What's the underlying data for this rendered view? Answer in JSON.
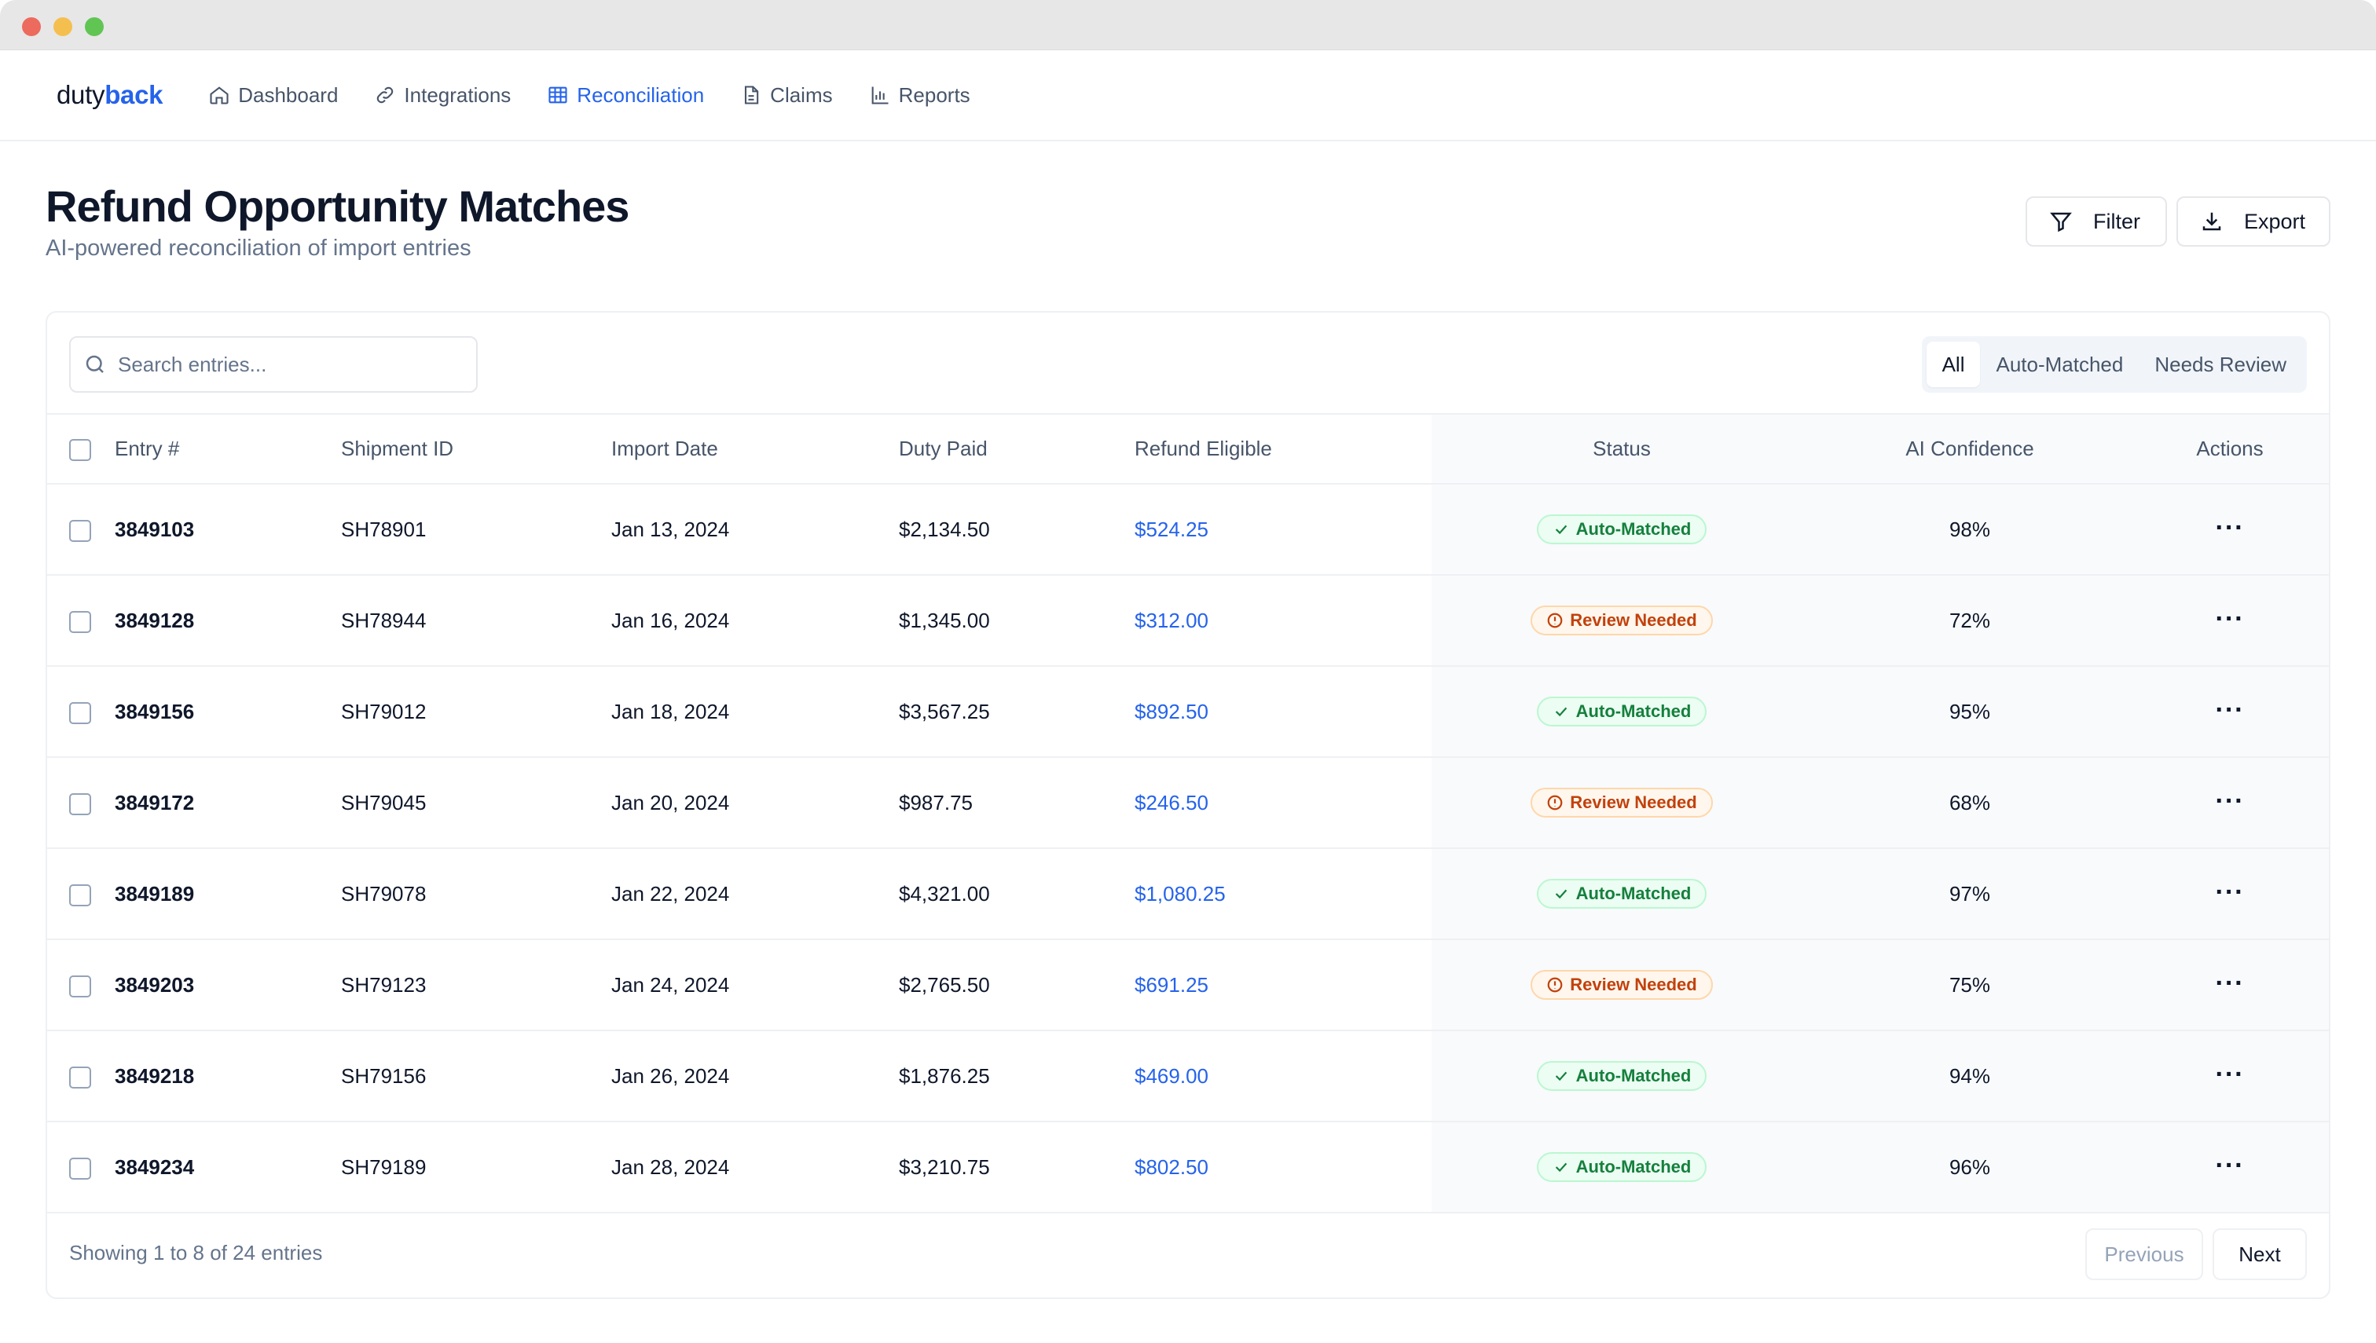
{
  "app": {
    "logo_light": "duty",
    "logo_bold": "back"
  },
  "nav": [
    {
      "label": "Dashboard",
      "icon": "home-icon",
      "active": false
    },
    {
      "label": "Integrations",
      "icon": "link-icon",
      "active": false
    },
    {
      "label": "Reconciliation",
      "icon": "table-icon",
      "active": true
    },
    {
      "label": "Claims",
      "icon": "document-icon",
      "active": false
    },
    {
      "label": "Reports",
      "icon": "bar-chart-icon",
      "active": false
    }
  ],
  "header": {
    "title": "Refund Opportunity Matches",
    "subtitle": "AI-powered reconciliation of import entries",
    "filter_label": "Filter",
    "export_label": "Export"
  },
  "search": {
    "placeholder": "Search entries...",
    "value": ""
  },
  "segments": [
    "All",
    "Auto-Matched",
    "Needs Review"
  ],
  "active_segment": "All",
  "table": {
    "columns": [
      "Entry #",
      "Shipment ID",
      "Import Date",
      "Duty Paid",
      "Refund Eligible",
      "Status",
      "AI Confidence",
      "Actions"
    ],
    "rows": [
      {
        "entry": "3849103",
        "shipment": "SH78901",
        "date": "Jan 13, 2024",
        "duty": "$2,134.50",
        "refund": "$524.25",
        "status": "Auto-Matched",
        "kind": "ok",
        "confidence": "98%"
      },
      {
        "entry": "3849128",
        "shipment": "SH78944",
        "date": "Jan 16, 2024",
        "duty": "$1,345.00",
        "refund": "$312.00",
        "status": "Review Needed",
        "kind": "warn",
        "confidence": "72%"
      },
      {
        "entry": "3849156",
        "shipment": "SH79012",
        "date": "Jan 18, 2024",
        "duty": "$3,567.25",
        "refund": "$892.50",
        "status": "Auto-Matched",
        "kind": "ok",
        "confidence": "95%"
      },
      {
        "entry": "3849172",
        "shipment": "SH79045",
        "date": "Jan 20, 2024",
        "duty": "$987.75",
        "refund": "$246.50",
        "status": "Review Needed",
        "kind": "warn",
        "confidence": "68%"
      },
      {
        "entry": "3849189",
        "shipment": "SH79078",
        "date": "Jan 22, 2024",
        "duty": "$4,321.00",
        "refund": "$1,080.25",
        "status": "Auto-Matched",
        "kind": "ok",
        "confidence": "97%"
      },
      {
        "entry": "3849203",
        "shipment": "SH79123",
        "date": "Jan 24, 2024",
        "duty": "$2,765.50",
        "refund": "$691.25",
        "status": "Review Needed",
        "kind": "warn",
        "confidence": "75%"
      },
      {
        "entry": "3849218",
        "shipment": "SH79156",
        "date": "Jan 26, 2024",
        "duty": "$1,876.25",
        "refund": "$469.00",
        "status": "Auto-Matched",
        "kind": "ok",
        "confidence": "94%"
      },
      {
        "entry": "3849234",
        "shipment": "SH79189",
        "date": "Jan 28, 2024",
        "duty": "$3,210.75",
        "refund": "$802.50",
        "status": "Auto-Matched",
        "kind": "ok",
        "confidence": "96%"
      }
    ]
  },
  "footer": {
    "showing": "Showing 1 to 8 of 24 entries",
    "previous_label": "Previous",
    "next_label": "Next"
  },
  "colors": {
    "accent": "#2563eb",
    "success": "#15803d",
    "warning": "#c2410c"
  }
}
